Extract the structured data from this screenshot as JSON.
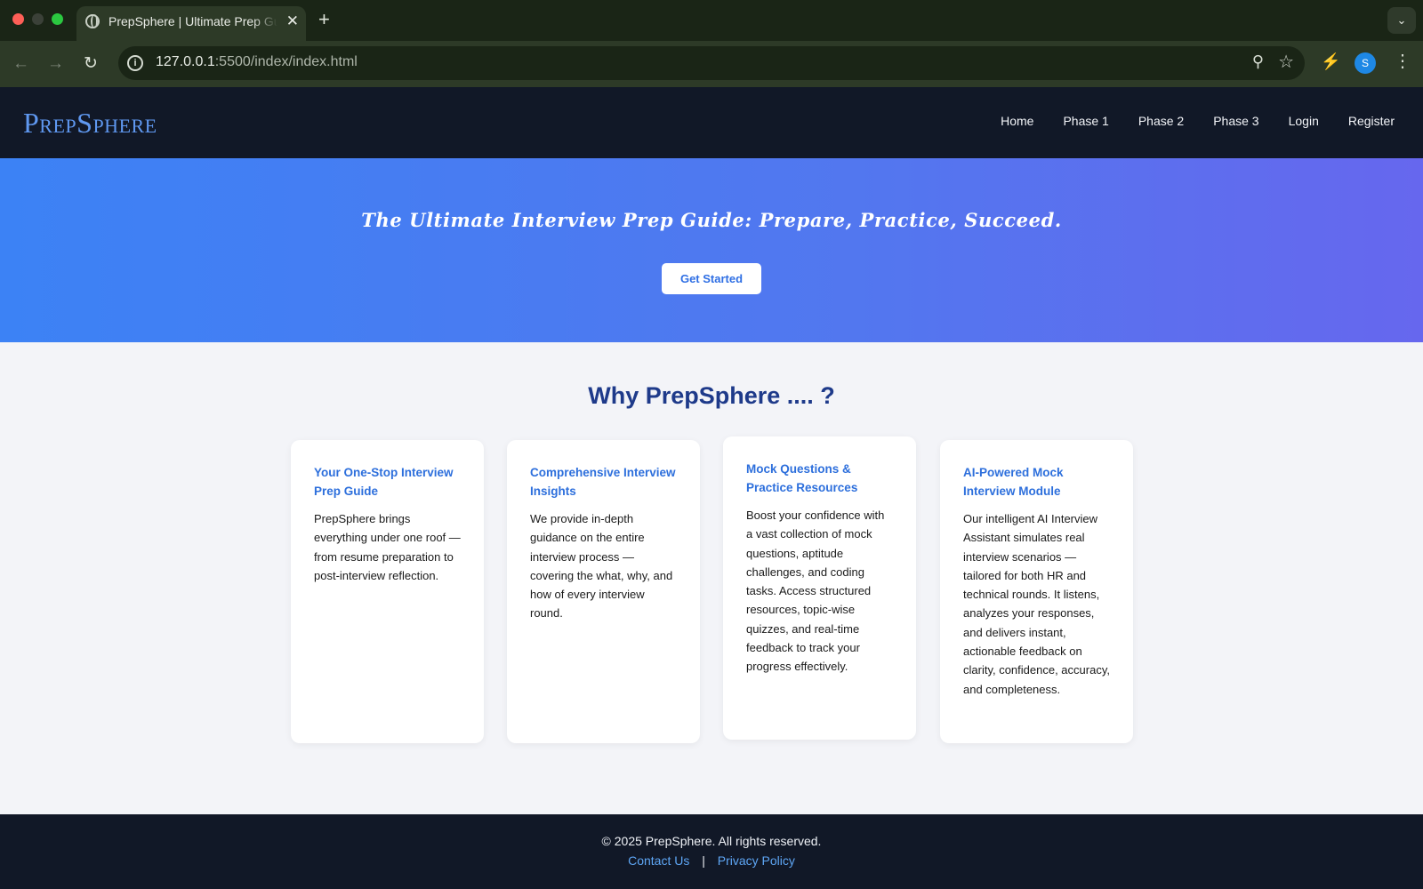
{
  "browser": {
    "tab_title": "PrepSphere | Ultimate Prep Guide",
    "tab_close": "✕",
    "new_tab": "+",
    "url_host": "127.0.0.1",
    "url_rest": ":5500/index/index.html",
    "profile_initial": "S"
  },
  "header": {
    "logo": "PrepSphere",
    "nav": [
      "Home",
      "Phase 1",
      "Phase 2",
      "Phase 3",
      "Login",
      "Register"
    ]
  },
  "hero": {
    "title": "The Ultimate Interview Prep Guide: Prepare, Practice, Succeed.",
    "button": "Get Started"
  },
  "why": {
    "title": "Why PrepSphere .... ?",
    "cards": [
      {
        "title": "Your One-Stop Interview Prep Guide",
        "text": "PrepSphere brings everything under one roof — from resume preparation to post-interview reflection."
      },
      {
        "title": "Comprehensive Interview Insights",
        "text": "We provide in-depth guidance on the entire interview process — covering the what, why, and how of every interview round."
      },
      {
        "title": "Mock Questions & Practice Resources",
        "text": "Boost your confidence with a vast collection of mock questions, aptitude challenges, and coding tasks. Access structured resources, topic-wise quizzes, and real-time feedback to track your progress effectively."
      },
      {
        "title": "AI-Powered Mock Interview Module",
        "text": "Our intelligent AI Interview Assistant simulates real interview scenarios — tailored for both HR and technical rounds. It listens, analyzes your responses, and delivers instant, actionable feedback on clarity, confidence, accuracy, and completeness."
      }
    ]
  },
  "footer": {
    "copyright": "© 2025 PrepSphere. All rights reserved.",
    "contact": "Contact Us",
    "separator": "|",
    "privacy": "Privacy Policy"
  },
  "colors": {
    "header_bg": "#111827",
    "accent": "#2d6fdc",
    "hero_start": "#3c82f5",
    "hero_end": "#6667ee",
    "why_title": "#1e3a8a"
  }
}
